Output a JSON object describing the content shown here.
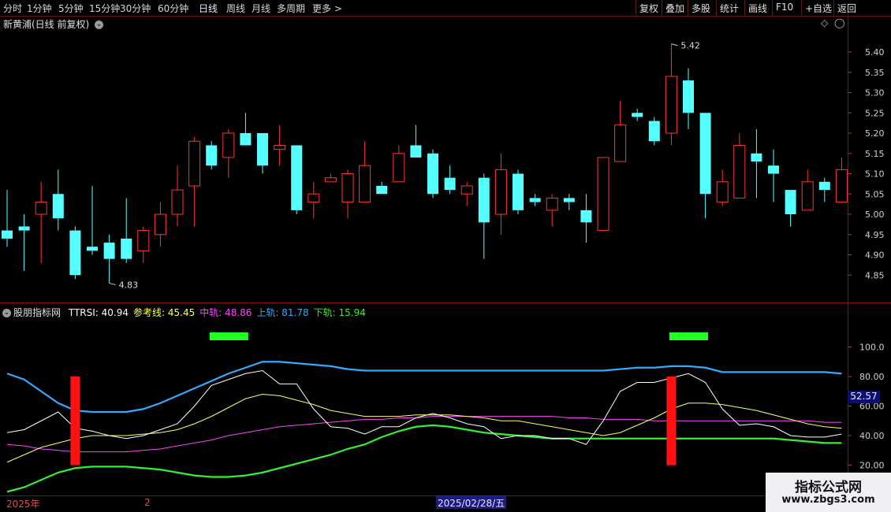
{
  "toolbar": {
    "periods": [
      "分时",
      "1分钟",
      "5分钟",
      "15分钟",
      "30分钟",
      "60分钟",
      "日线",
      "周线",
      "月线",
      "多周期",
      "更多 >"
    ],
    "active": "日线",
    "right_buttons": [
      "复权",
      "叠加",
      "多股",
      "统计",
      "画线",
      "F10",
      "+自选",
      "返回"
    ]
  },
  "main_chart": {
    "title": "新黄浦(日线 前复权)",
    "high_label": "5.42",
    "low_label": "4.83",
    "y_ticks": [
      "5.40",
      "5.35",
      "5.30",
      "5.25",
      "5.20",
      "5.15",
      "5.10",
      "5.05",
      "5.00",
      "4.95",
      "4.90",
      "4.85"
    ]
  },
  "indicator": {
    "name": "股朋指标网",
    "items": [
      {
        "label": "TTRSI:",
        "value": "40.94",
        "color": "#ffffff"
      },
      {
        "label": "参考线:",
        "value": "45.45",
        "color": "#ffff66"
      },
      {
        "label": "中轨:",
        "value": "48.86",
        "color": "#ff44ff"
      },
      {
        "label": "上轨:",
        "value": "81.78",
        "color": "#33aaff"
      },
      {
        "label": "下轨:",
        "value": "15.94",
        "color": "#33ee33"
      }
    ],
    "y_ticks": [
      "100.0",
      "80.00",
      "60.00",
      "40.00",
      "20.00"
    ],
    "current_value": "52.57"
  },
  "axis": {
    "year_label": "2025年",
    "month_label": "2",
    "cursor_date": "2025/02/28/五"
  },
  "watermark": {
    "line1": "指标公式网",
    "line2": "www.zbgs3.com"
  },
  "colors": {
    "up": "#ff3333",
    "down": "#55ffff",
    "grid": "#6a0a0a",
    "axis_text": "#d0d0d0"
  },
  "chart_data": {
    "type": "candlestick",
    "ylim": [
      4.8,
      5.47
    ],
    "candles": [
      [
        4.96,
        4.94,
        5.06,
        4.92
      ],
      [
        4.97,
        4.96,
        5.0,
        4.86
      ],
      [
        5.0,
        5.03,
        5.08,
        4.88
      ],
      [
        5.05,
        4.99,
        5.11,
        4.96
      ],
      [
        4.96,
        4.85,
        4.97,
        4.84
      ],
      [
        4.92,
        4.91,
        5.07,
        4.9
      ],
      [
        4.93,
        4.89,
        4.95,
        4.83
      ],
      [
        4.94,
        4.89,
        5.04,
        4.88
      ],
      [
        4.91,
        4.96,
        4.97,
        4.88
      ],
      [
        4.95,
        5.0,
        5.03,
        4.92
      ],
      [
        5.0,
        5.06,
        5.12,
        4.97
      ],
      [
        5.07,
        5.18,
        5.19,
        4.97
      ],
      [
        5.17,
        5.12,
        5.18,
        5.11
      ],
      [
        5.14,
        5.2,
        5.21,
        5.09
      ],
      [
        5.2,
        5.17,
        5.25,
        5.17
      ],
      [
        5.2,
        5.12,
        5.2,
        5.1
      ],
      [
        5.16,
        5.17,
        5.22,
        5.12
      ],
      [
        5.17,
        5.01,
        5.17,
        5.0
      ],
      [
        5.03,
        5.05,
        5.08,
        4.99
      ],
      [
        5.08,
        5.09,
        5.1,
        5.08
      ],
      [
        5.03,
        5.1,
        5.11,
        4.99
      ],
      [
        5.03,
        5.12,
        5.18,
        5.03
      ],
      [
        5.07,
        5.05,
        5.08,
        5.05
      ],
      [
        5.08,
        5.15,
        5.17,
        5.09
      ],
      [
        5.17,
        5.14,
        5.22,
        5.14
      ],
      [
        5.15,
        5.05,
        5.16,
        5.04
      ],
      [
        5.09,
        5.06,
        5.12,
        5.05
      ],
      [
        5.05,
        5.07,
        5.08,
        5.02
      ],
      [
        5.09,
        4.98,
        5.1,
        4.89
      ],
      [
        5.0,
        5.11,
        5.15,
        4.95
      ],
      [
        5.1,
        5.01,
        5.11,
        5.0
      ],
      [
        5.04,
        5.03,
        5.05,
        5.02
      ],
      [
        5.01,
        5.04,
        5.05,
        4.97
      ],
      [
        5.04,
        5.03,
        5.05,
        5.01
      ],
      [
        5.01,
        4.98,
        5.05,
        4.93
      ],
      [
        4.96,
        5.14,
        5.14,
        4.96
      ],
      [
        5.13,
        5.22,
        5.28,
        5.13
      ],
      [
        5.25,
        5.24,
        5.26,
        5.23
      ],
      [
        5.23,
        5.18,
        5.24,
        5.17
      ],
      [
        5.2,
        5.34,
        5.42,
        5.17
      ],
      [
        5.33,
        5.25,
        5.36,
        5.21
      ],
      [
        5.25,
        5.05,
        5.25,
        4.99
      ],
      [
        5.03,
        5.08,
        5.11,
        5.02
      ],
      [
        5.04,
        5.17,
        5.2,
        5.04
      ],
      [
        5.15,
        5.13,
        5.21,
        5.04
      ],
      [
        5.12,
        5.1,
        5.16,
        5.03
      ],
      [
        5.06,
        5.0,
        5.06,
        4.97
      ],
      [
        5.01,
        5.08,
        5.11,
        5.01
      ],
      [
        5.08,
        5.06,
        5.09,
        5.03
      ],
      [
        5.03,
        5.11,
        5.14,
        5.03
      ]
    ],
    "indicator_series": {
      "ylim": [
        0,
        120
      ],
      "TTRSI": [
        42,
        44,
        50,
        56,
        45,
        43,
        40,
        38,
        40,
        44,
        48,
        60,
        74,
        78,
        82,
        84,
        75,
        75,
        58,
        46,
        45,
        41,
        46,
        46,
        52,
        55,
        52,
        48,
        46,
        38,
        40,
        40,
        38,
        38,
        34,
        50,
        70,
        76,
        76,
        79,
        82,
        76,
        58,
        47,
        48,
        46,
        40,
        39,
        39,
        41
      ],
      "参考线": [
        22,
        27,
        32,
        35,
        38,
        40,
        40,
        40,
        41,
        42,
        44,
        48,
        53,
        59,
        65,
        68,
        67,
        64,
        61,
        57,
        55,
        53,
        53,
        53,
        54,
        54,
        54,
        53,
        52,
        50,
        50,
        48,
        46,
        44,
        42,
        40,
        42,
        47,
        52,
        58,
        62,
        62,
        61,
        59,
        57,
        54,
        51,
        48,
        46,
        45
      ],
      "中轨": [
        34,
        33,
        31,
        30,
        29,
        29,
        29,
        29,
        30,
        31,
        33,
        35,
        37,
        40,
        42,
        44,
        46,
        47,
        48,
        49,
        50,
        51,
        51,
        52,
        52,
        53,
        53,
        53,
        53,
        53,
        53,
        53,
        53,
        52,
        52,
        51,
        51,
        51,
        50,
        50,
        50,
        50,
        50,
        50,
        50,
        50,
        50,
        50,
        49,
        49
      ],
      "上轨": [
        82,
        78,
        70,
        62,
        57,
        56,
        56,
        56,
        58,
        62,
        67,
        72,
        77,
        82,
        86,
        90,
        90,
        89,
        88,
        87,
        85,
        84,
        84,
        84,
        84,
        84,
        84,
        84,
        84,
        84,
        84,
        84,
        84,
        84,
        84,
        84,
        85,
        86,
        86,
        87,
        87,
        86,
        83,
        83,
        83,
        83,
        83,
        83,
        83,
        82
      ],
      "下轨": [
        2,
        5,
        10,
        15,
        18,
        19,
        19,
        19,
        18,
        17,
        15,
        13,
        12,
        12,
        13,
        15,
        18,
        21,
        24,
        27,
        31,
        34,
        39,
        43,
        46,
        47,
        46,
        44,
        42,
        41,
        40,
        39,
        38,
        38,
        38,
        38,
        38,
        38,
        38,
        38,
        38,
        38,
        38,
        38,
        38,
        38,
        37,
        36,
        35,
        35
      ],
      "red_bars": [
        4,
        39
      ],
      "green_marks": [
        13,
        40
      ]
    }
  }
}
